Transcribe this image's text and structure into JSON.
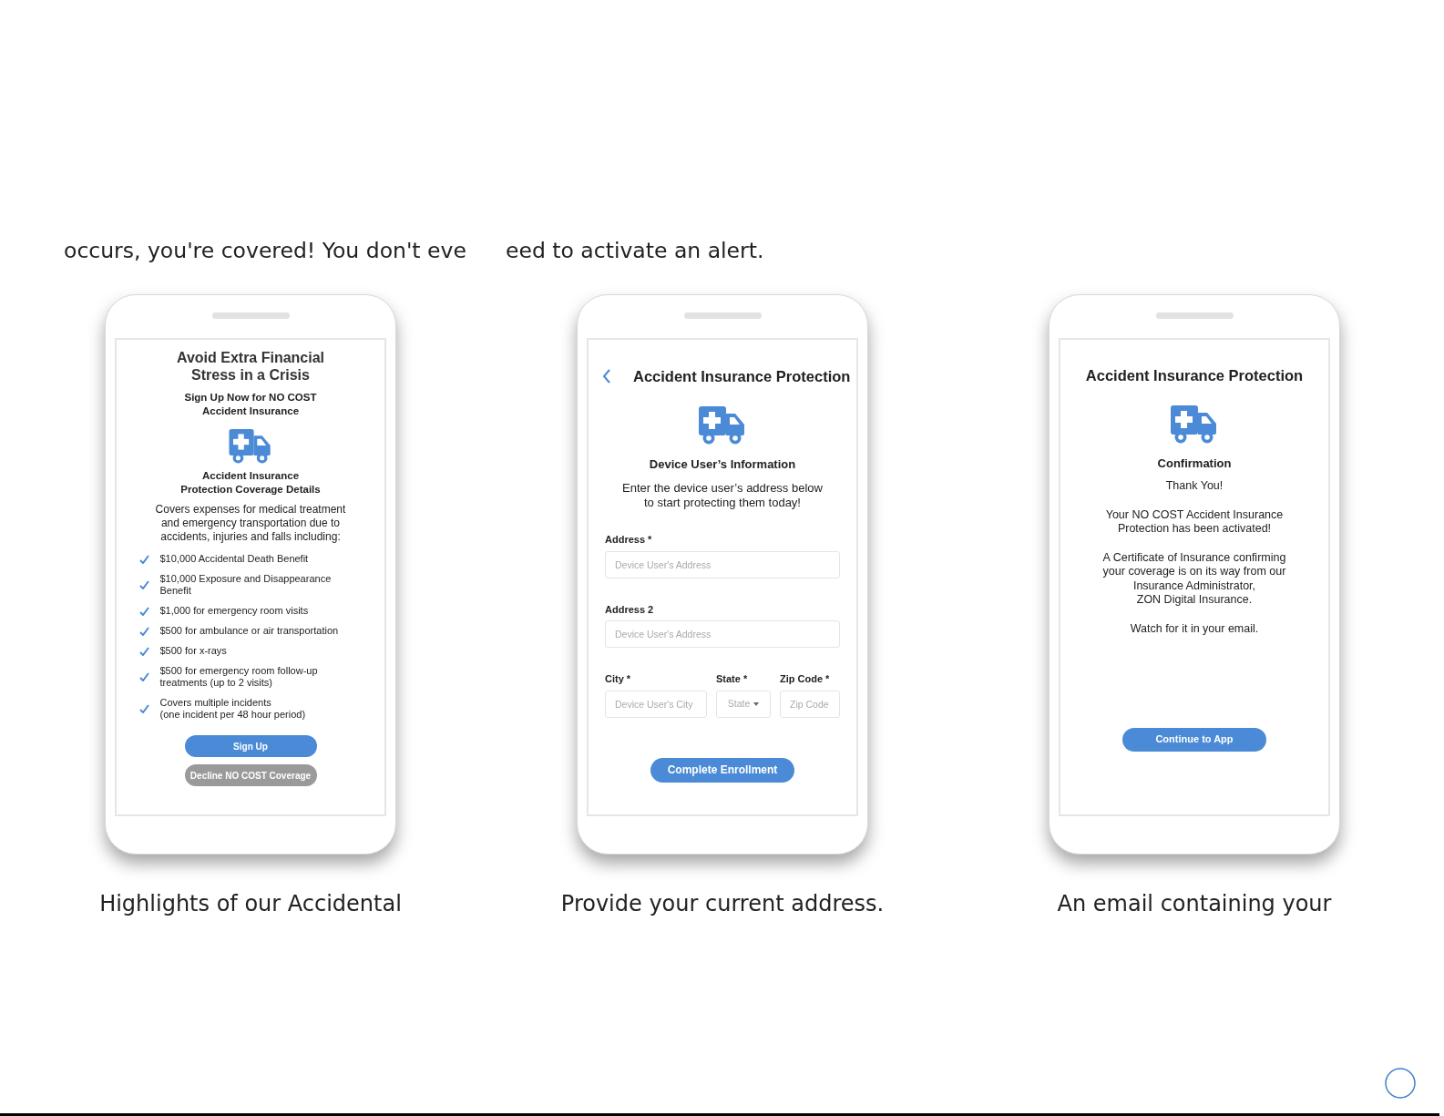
{
  "intro": [
    "occurs, you're covered! You don't eve",
    "eed to activate an alert."
  ],
  "phones": [
    {
      "kind": "offer",
      "title": [
        "Avoid Extra Financial",
        "Stress in a Crisis"
      ],
      "subtitle": [
        "Sign Up Now for NO COST",
        "Accident Insurance"
      ],
      "heading": [
        "Accident Insurance",
        "Protection Coverage Details"
      ],
      "description": [
        "Covers expenses for medical treatment",
        "and emergency transportation due to",
        "accidents, injuries and falls including:"
      ],
      "benefits": [
        [
          "$10,000 Accidental Death Benefit"
        ],
        [
          "$10,000 Exposure and Disappearance",
          "Benefit"
        ],
        [
          "$1,000 for emergency room visits"
        ],
        [
          "$500 for ambulance or air transportation"
        ],
        [
          "$500 for x-rays"
        ],
        [
          "$500 for emergency room follow-up",
          "treatments (up to 2 visits)"
        ],
        [
          "Covers multiple incidents",
          "(one incident per 48 hour period)"
        ]
      ],
      "buttons": [
        {
          "label": "Sign Up",
          "kind": "primary"
        },
        {
          "label": "Decline NO COST Coverage",
          "kind": "secondary"
        }
      ],
      "caption": "Highlights of our Accidental"
    },
    {
      "kind": "form",
      "title": "Accident Insurance Protection",
      "heading": [
        "Device User’s Information"
      ],
      "description": [
        "Enter the device user’s address below",
        "to start protecting them today!"
      ],
      "fields": [
        {
          "label": "Address *",
          "placeholder": "Device User's Address"
        },
        {
          "label": "Address 2",
          "placeholder": "Device User's Address"
        }
      ],
      "row_fields": [
        {
          "label": "City *",
          "placeholder": "Device User's City",
          "kind": "text"
        },
        {
          "label": "State *",
          "placeholder": "State",
          "kind": "dropdown"
        },
        {
          "label": "Zip Code *",
          "placeholder": "Zip Code",
          "kind": "text"
        }
      ],
      "buttons": [
        {
          "label": "Complete Enrollment",
          "kind": "primary"
        }
      ],
      "caption": "Provide your current address."
    },
    {
      "kind": "confirmation",
      "title": "Accident Insurance Protection",
      "heading": [
        "Confirmation"
      ],
      "paragraphs": [
        [
          "Thank You!"
        ],
        [
          "Your NO COST Accident Insurance",
          "Protection has been activated!"
        ],
        [
          "A Certificate of Insurance confirming",
          "your coverage is on its way from our",
          "Insurance Administrator,",
          "ZON Digital Insurance."
        ],
        [
          "Watch for it in your email."
        ]
      ],
      "buttons": [
        {
          "label": "Continue to App",
          "kind": "primary"
        }
      ],
      "caption": "An email containing your"
    }
  ]
}
